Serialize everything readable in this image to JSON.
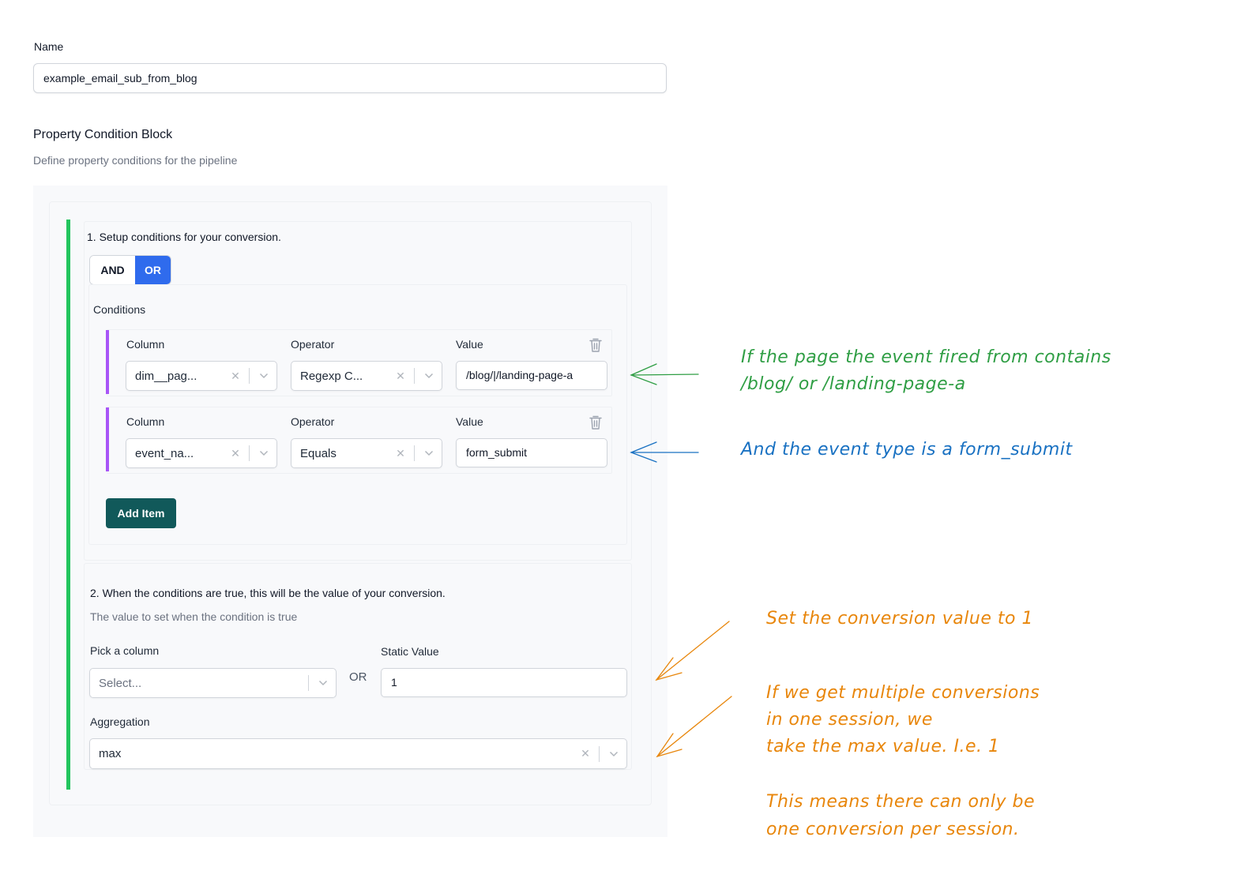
{
  "form": {
    "name_label": "Name",
    "name_value": "example_email_sub_from_blog",
    "section_title": "Property Condition Block",
    "section_description": "Define property conditions for the pipeline"
  },
  "step1": {
    "title": "1. Setup conditions for your conversion.",
    "logic_toggle": {
      "options": [
        "AND",
        "OR"
      ],
      "selected": "OR"
    },
    "conditions_label": "Conditions",
    "conditions": [
      {
        "column_label": "Column",
        "column_value": "dim__pag...",
        "operator_label": "Operator",
        "operator_value": "Regexp C...",
        "value_label": "Value",
        "value": "/blog/|/landing-page-a",
        "delete_icon": "trash-icon"
      },
      {
        "column_label": "Column",
        "column_value": "event_na...",
        "operator_label": "Operator",
        "operator_value": "Equals",
        "value_label": "Value",
        "value": "form_submit",
        "delete_icon": "trash-icon"
      }
    ],
    "add_item_label": "Add Item"
  },
  "step2": {
    "title": "2. When the conditions are true, this will be the value of your conversion.",
    "description": "The value to set when the condition is true",
    "pick_column_label": "Pick a column",
    "pick_column_placeholder": "Select...",
    "or_label": "OR",
    "static_value_label": "Static Value",
    "static_value": "1",
    "aggregation_label": "Aggregation",
    "aggregation_value": "max"
  },
  "icons": {
    "clear": "x-icon",
    "dropdown": "chevron-down-icon",
    "delete": "trash-icon"
  },
  "annotations": [
    {
      "lines": [
        "If the page the event fired from contains",
        "/blog/ or /landing-page-a"
      ],
      "color": "#2f9e44"
    },
    {
      "lines": [
        "And the event type is a form_submit"
      ],
      "color": "#1971c2"
    },
    {
      "lines": [
        "Set the conversion value to 1"
      ],
      "color": "#e8860b"
    },
    {
      "lines": [
        "If we get multiple conversions",
        "in one session, we",
        "take the max value. I.e. 1"
      ],
      "color": "#e8860b"
    },
    {
      "lines": [
        "This means there can only be",
        "one conversion per session."
      ],
      "color": "#e8860b"
    }
  ],
  "colors": {
    "toggle_selected": "#2f6bed",
    "add_button": "#11595a",
    "step_accent": "#22c55e",
    "condition_accent": "#a855f7"
  }
}
